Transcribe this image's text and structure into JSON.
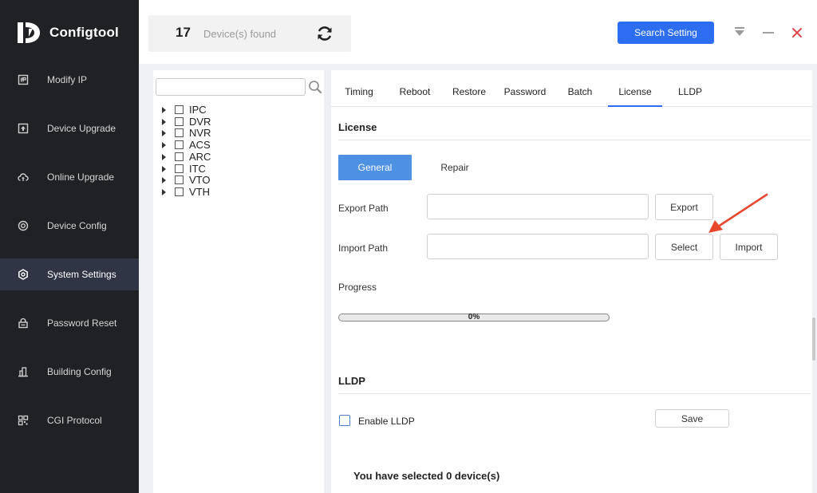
{
  "app": {
    "title": "Configtool"
  },
  "sidebar": {
    "items": [
      {
        "label": "Modify IP",
        "icon": "ip-icon",
        "active": false
      },
      {
        "label": "Device Upgrade",
        "icon": "upgrade-icon",
        "active": false
      },
      {
        "label": "Online Upgrade",
        "icon": "cloud-upload-icon",
        "active": false
      },
      {
        "label": "Device Config",
        "icon": "device-config-icon",
        "active": false
      },
      {
        "label": "System Settings",
        "icon": "settings-icon",
        "active": true
      },
      {
        "label": "Password Reset",
        "icon": "lock-icon",
        "active": false
      },
      {
        "label": "Building Config",
        "icon": "building-icon",
        "active": false
      },
      {
        "label": "CGI Protocol",
        "icon": "grid-icon",
        "active": false
      }
    ]
  },
  "header": {
    "device_count": "17",
    "device_text": "Device(s) found",
    "search_setting_label": "Search Setting"
  },
  "tree": {
    "search_placeholder": "",
    "items": [
      "IPC",
      "DVR",
      "NVR",
      "ACS",
      "ARC",
      "ITC",
      "VTO",
      "VTH"
    ]
  },
  "tabs": [
    {
      "label": "Timing",
      "active": false
    },
    {
      "label": "Reboot",
      "active": false
    },
    {
      "label": "Restore",
      "active": false
    },
    {
      "label": "Password",
      "active": false
    },
    {
      "label": "Batch",
      "active": false
    },
    {
      "label": "License",
      "active": true
    },
    {
      "label": "LLDP",
      "active": false
    }
  ],
  "license": {
    "title": "License",
    "general_label": "General",
    "repair_label": "Repair",
    "export_path_label": "Export Path",
    "export_path_value": "",
    "export_button": "Export",
    "import_path_label": "Import Path",
    "import_path_value": "",
    "select_button": "Select",
    "import_button": "Import",
    "progress_label": "Progress",
    "progress_value": 0,
    "progress_text": "0%"
  },
  "lldp": {
    "title": "LLDP",
    "enable_label": "Enable LLDP",
    "enabled": false,
    "save_button": "Save"
  },
  "footer": {
    "selected_text": "You have selected 0 device(s)"
  },
  "colors": {
    "sidebar_bg": "#202124",
    "accent": "#2d6ef0",
    "general_button": "#4e90e2",
    "close_icon": "#e04848",
    "annotation_arrow": "#e8472f"
  }
}
